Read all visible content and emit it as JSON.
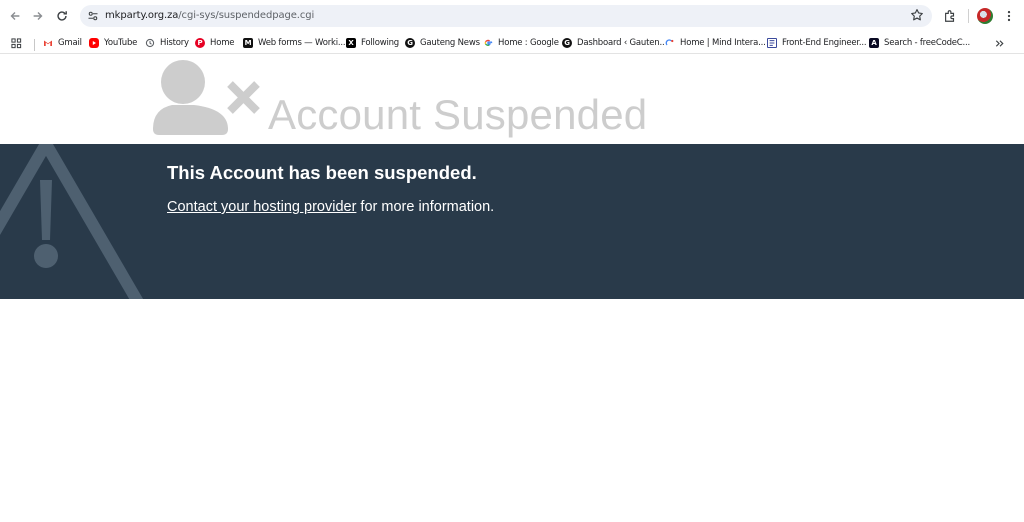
{
  "browser": {
    "url_host": "mkparty.org.za",
    "url_path": "/cgi-sys/suspendedpage.cgi"
  },
  "bookmarks": [
    {
      "label": "Gmail",
      "icon": "gmail-icon",
      "color": "#EA4335"
    },
    {
      "label": "YouTube",
      "icon": "youtube-icon",
      "color": "#FF0000"
    },
    {
      "label": "History",
      "icon": "history-icon",
      "color": "#5f6368"
    },
    {
      "label": "Home",
      "icon": "pinterest-icon",
      "color": "#E60023"
    },
    {
      "label": "Web forms — Worki...",
      "icon": "webforms-icon",
      "color": "#111111"
    },
    {
      "label": "Following",
      "icon": "x-icon",
      "color": "#000000"
    },
    {
      "label": "Gauteng News",
      "icon": "gauteng-news-icon",
      "color": "#111111"
    },
    {
      "label": "Home : Google",
      "icon": "google-icon",
      "color": "#4285F4"
    },
    {
      "label": "Dashboard ‹ Gauten...",
      "icon": "dashboard-icon",
      "color": "#111111"
    },
    {
      "label": "Home | Mind Intera...",
      "icon": "mind-icon",
      "color": "#4285F4"
    },
    {
      "label": "Front-End Engineer...",
      "icon": "frontend-icon",
      "color": "#3b4a9c"
    },
    {
      "label": "Search - freeCodeC...",
      "icon": "freecodecamp-icon",
      "color": "#0a0a23"
    }
  ],
  "page": {
    "headline": "Account Suspended",
    "message_title": "This Account has been suspended.",
    "link_text": "Contact your hosting provider",
    "message_suffix": " for more information."
  },
  "colors": {
    "banner": "#293a4a",
    "graphic": "#cdcdcd",
    "warning_mark": "#4e6070"
  }
}
